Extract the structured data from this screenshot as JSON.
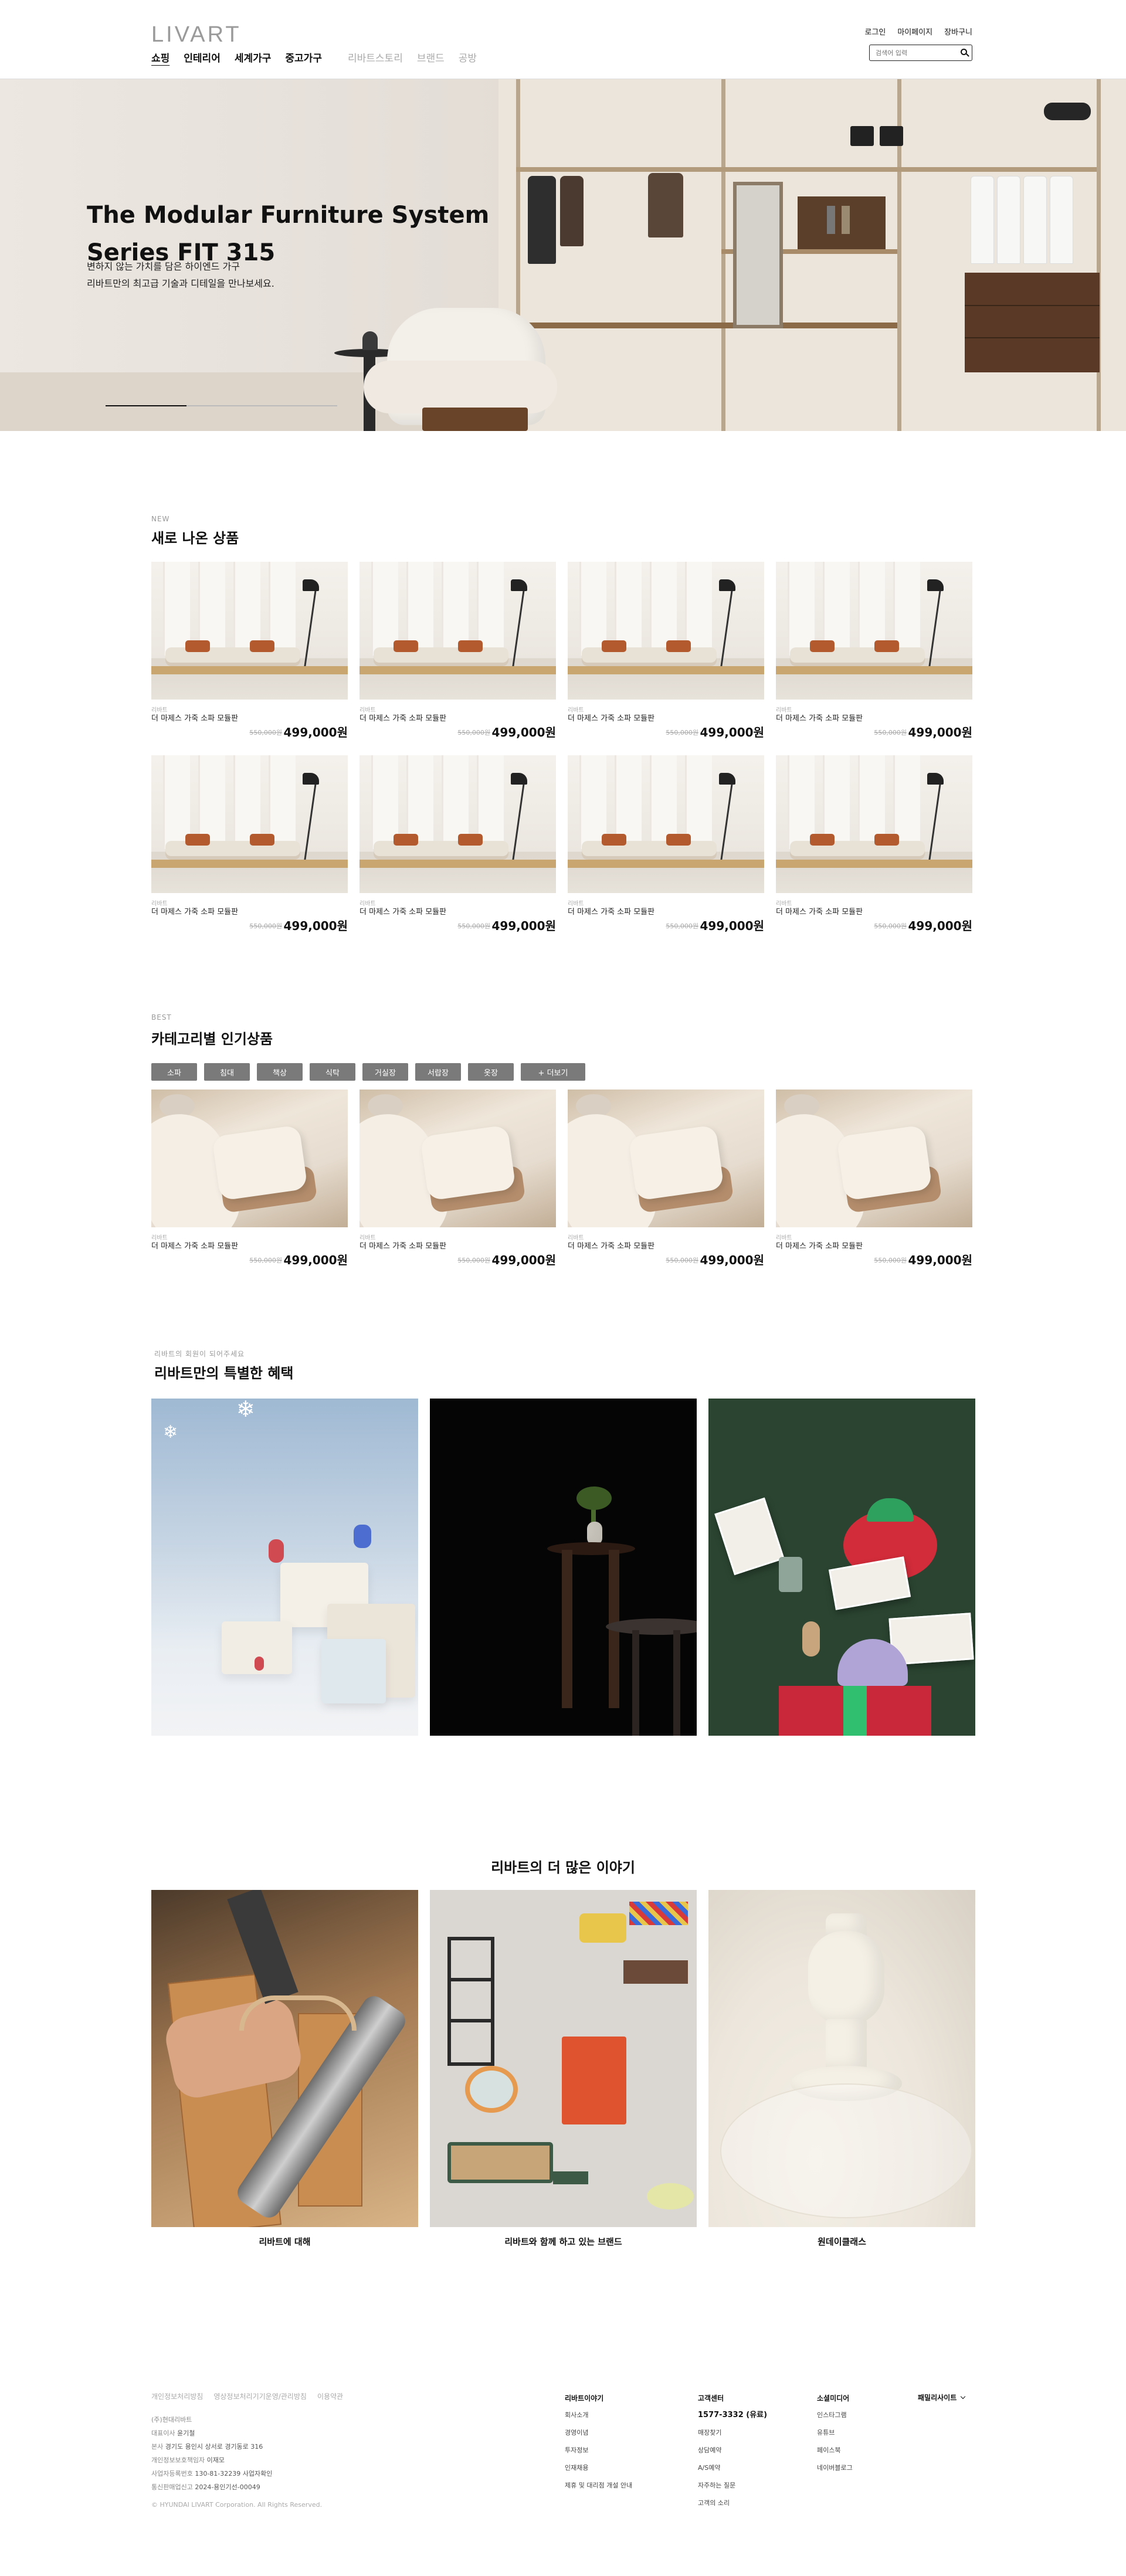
{
  "header": {
    "logo": "LIVART",
    "gnb": [
      "쇼핑",
      "인테리어",
      "세계가구",
      "중고가구"
    ],
    "gnb_secondary": [
      "리바트스토리",
      "브랜드",
      "공방"
    ],
    "util": [
      "로그인",
      "마이페이지",
      "장바구니"
    ],
    "search_placeholder": "검색어 입력"
  },
  "hero": {
    "title": "The Modular Furniture System Series FIT 315",
    "subtitle_line1": "변하지 않는 가치를 담은 하이엔드 가구",
    "subtitle_line2": "리바트만의 최고급 기술과 디테일을 만나보세요.",
    "progress": 0.35
  },
  "new_section": {
    "eyebrow": "NEW",
    "title": "새로 나온 상품",
    "products": [
      {
        "brand": "리바트",
        "name": "더 마제스 가죽 소파 모듈판",
        "original": "550,000원",
        "price": "499,000원"
      },
      {
        "brand": "리바트",
        "name": "더 마제스 가죽 소파 모듈판",
        "original": "550,000원",
        "price": "499,000원"
      },
      {
        "brand": "리바트",
        "name": "더 마제스 가죽 소파 모듈판",
        "original": "550,000원",
        "price": "499,000원"
      },
      {
        "brand": "리바트",
        "name": "더 마제스 가죽 소파 모듈판",
        "original": "550,000원",
        "price": "499,000원"
      },
      {
        "brand": "리바트",
        "name": "더 마제스 가죽 소파 모듈판",
        "original": "550,000원",
        "price": "499,000원"
      },
      {
        "brand": "리바트",
        "name": "더 마제스 가죽 소파 모듈판",
        "original": "550,000원",
        "price": "499,000원"
      },
      {
        "brand": "리바트",
        "name": "더 마제스 가죽 소파 모듈판",
        "original": "550,000원",
        "price": "499,000원"
      },
      {
        "brand": "리바트",
        "name": "더 마제스 가죽 소파 모듈판",
        "original": "550,000원",
        "price": "499,000원"
      }
    ]
  },
  "best_section": {
    "eyebrow": "BEST",
    "title": "카테고리별 인기상품",
    "tabs": [
      "소파",
      "침대",
      "책상",
      "식탁",
      "거실장",
      "서랍장",
      "옷장",
      "+ 더보기"
    ],
    "products": [
      {
        "brand": "리바트",
        "name": "더 마제스 가죽 소파 모듈판",
        "original": "550,000원",
        "price": "499,000원"
      },
      {
        "brand": "리바트",
        "name": "더 마제스 가죽 소파 모듈판",
        "original": "550,000원",
        "price": "499,000원"
      },
      {
        "brand": "리바트",
        "name": "더 마제스 가죽 소파 모듈판",
        "original": "550,000원",
        "price": "499,000원"
      },
      {
        "brand": "리바트",
        "name": "더 마제스 가죽 소파 모듈판",
        "original": "550,000원",
        "price": "499,000원"
      }
    ]
  },
  "benefit_section": {
    "eyebrow": "리바트의 회원이 되어주세요",
    "title": "리바트만의 특별한 혜택"
  },
  "story_section": {
    "title": "리바트의 더 많은 이야기",
    "items": [
      "리바트에 대해",
      "리바트와 함께 하고 있는 브랜드",
      "원데이클래스"
    ]
  },
  "footer": {
    "links": [
      "개인정보처리방침",
      "영상정보처리기기운영/관리방침",
      "이용약관"
    ],
    "company": "(주)현대리바트",
    "ceo_label": "대표이사",
    "ceo": "윤기철",
    "addr_label": "본사",
    "addr": "경기도 용인시 상서로 경기동로 316",
    "privacy_label": "개인정보보호책임자",
    "privacy": "이재모",
    "biz_label": "사업자등록번호",
    "biz": "130-81-32239 사업자확인",
    "mail_label": "통신판매업신고",
    "mail": "2024-용인기선-00049",
    "copyright": "© HYUNDAI LIVART Corporation. All Rights Reserved.",
    "col1": {
      "title": "리바트이야기",
      "items": [
        "회사소개",
        "경영이념",
        "투자정보",
        "인재채용",
        "제휴 및 대리점 개설 안내"
      ]
    },
    "col2": {
      "title": "고객센터",
      "tel": "1577-3332 (유료)",
      "items": [
        "매장찾기",
        "상담예약",
        "A/S예약",
        "자주하는 질문",
        "고객의 소리"
      ]
    },
    "col3": {
      "title": "소셜미디어",
      "items": [
        "인스타그램",
        "유튜브",
        "페이스북",
        "네이버블로그"
      ]
    },
    "family": "패밀리사이트"
  }
}
